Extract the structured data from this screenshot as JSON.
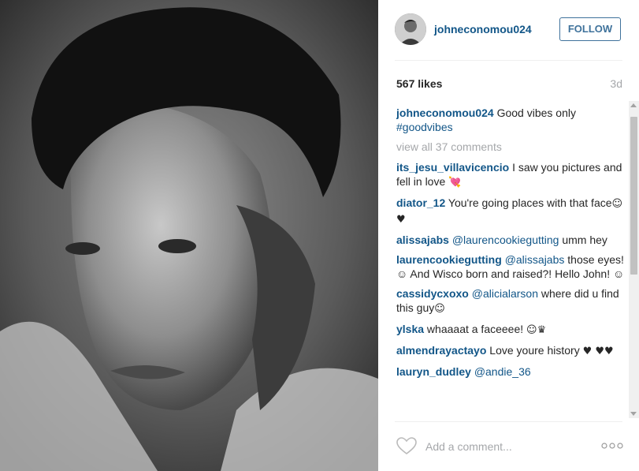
{
  "post": {
    "username": "johneconomou024",
    "follow_label": "FOLLOW",
    "likes": "567 likes",
    "time_ago": "3d",
    "caption": {
      "user": "johneconomou024",
      "text": " Good vibes only ",
      "hashtag": "#goodvibes"
    },
    "view_all": "view all 37 comments",
    "comments": [
      {
        "user": "its_jesu_villavicencio",
        "text": " I saw you pictures and fell in love ",
        "emoji": "💘"
      },
      {
        "user": "diator_12",
        "text": " You're going places with that face",
        "emoji": "☺♥"
      },
      {
        "user": "alissajabs",
        "mention": "@laurencookiegutting",
        "text": " umm hey"
      },
      {
        "user": "laurencookiegutting",
        "mention": "@alissajabs",
        "text": " those eyes! ☺ And Wisco born and raised?! Hello John! ☺"
      },
      {
        "user": "cassidycxoxo",
        "mention": "@alicialarson",
        "text": " where did u find this guy",
        "emoji": "☺"
      },
      {
        "user": "ylska",
        "text": " whaaaat a faceeee! ",
        "emoji": "☺♛"
      },
      {
        "user": "almendrayactayo",
        "text": " Love youre history ",
        "emoji": "♥ ♥♥"
      },
      {
        "user": "lauryn_dudley",
        "mention": "@andie_36",
        "text": ""
      }
    ],
    "comment_placeholder": "Add a comment..."
  },
  "icons": {
    "like": "heart-outline-icon",
    "more": "more-options-icon"
  },
  "colors": {
    "link": "#125688",
    "follow": "#3f729b",
    "muted": "#a5a7aa"
  }
}
